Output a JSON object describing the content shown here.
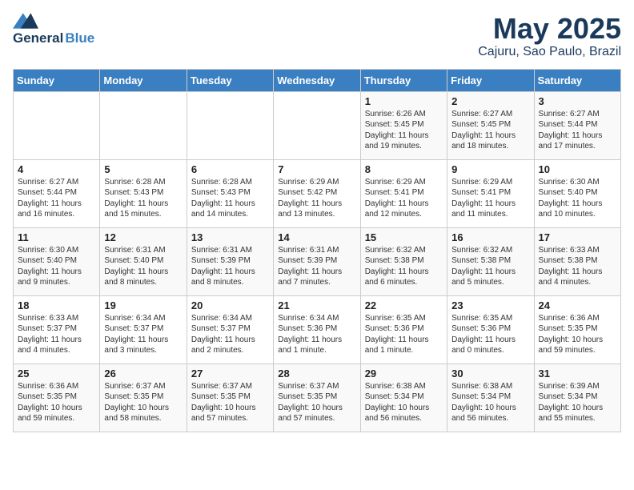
{
  "logo": {
    "general": "General",
    "blue": "Blue"
  },
  "title": "May 2025",
  "subtitle": "Cajuru, Sao Paulo, Brazil",
  "days_of_week": [
    "Sunday",
    "Monday",
    "Tuesday",
    "Wednesday",
    "Thursday",
    "Friday",
    "Saturday"
  ],
  "weeks": [
    [
      {
        "num": "",
        "info": ""
      },
      {
        "num": "",
        "info": ""
      },
      {
        "num": "",
        "info": ""
      },
      {
        "num": "",
        "info": ""
      },
      {
        "num": "1",
        "info": "Sunrise: 6:26 AM\nSunset: 5:45 PM\nDaylight: 11 hours\nand 19 minutes."
      },
      {
        "num": "2",
        "info": "Sunrise: 6:27 AM\nSunset: 5:45 PM\nDaylight: 11 hours\nand 18 minutes."
      },
      {
        "num": "3",
        "info": "Sunrise: 6:27 AM\nSunset: 5:44 PM\nDaylight: 11 hours\nand 17 minutes."
      }
    ],
    [
      {
        "num": "4",
        "info": "Sunrise: 6:27 AM\nSunset: 5:44 PM\nDaylight: 11 hours\nand 16 minutes."
      },
      {
        "num": "5",
        "info": "Sunrise: 6:28 AM\nSunset: 5:43 PM\nDaylight: 11 hours\nand 15 minutes."
      },
      {
        "num": "6",
        "info": "Sunrise: 6:28 AM\nSunset: 5:43 PM\nDaylight: 11 hours\nand 14 minutes."
      },
      {
        "num": "7",
        "info": "Sunrise: 6:29 AM\nSunset: 5:42 PM\nDaylight: 11 hours\nand 13 minutes."
      },
      {
        "num": "8",
        "info": "Sunrise: 6:29 AM\nSunset: 5:41 PM\nDaylight: 11 hours\nand 12 minutes."
      },
      {
        "num": "9",
        "info": "Sunrise: 6:29 AM\nSunset: 5:41 PM\nDaylight: 11 hours\nand 11 minutes."
      },
      {
        "num": "10",
        "info": "Sunrise: 6:30 AM\nSunset: 5:40 PM\nDaylight: 11 hours\nand 10 minutes."
      }
    ],
    [
      {
        "num": "11",
        "info": "Sunrise: 6:30 AM\nSunset: 5:40 PM\nDaylight: 11 hours\nand 9 minutes."
      },
      {
        "num": "12",
        "info": "Sunrise: 6:31 AM\nSunset: 5:40 PM\nDaylight: 11 hours\nand 8 minutes."
      },
      {
        "num": "13",
        "info": "Sunrise: 6:31 AM\nSunset: 5:39 PM\nDaylight: 11 hours\nand 8 minutes."
      },
      {
        "num": "14",
        "info": "Sunrise: 6:31 AM\nSunset: 5:39 PM\nDaylight: 11 hours\nand 7 minutes."
      },
      {
        "num": "15",
        "info": "Sunrise: 6:32 AM\nSunset: 5:38 PM\nDaylight: 11 hours\nand 6 minutes."
      },
      {
        "num": "16",
        "info": "Sunrise: 6:32 AM\nSunset: 5:38 PM\nDaylight: 11 hours\nand 5 minutes."
      },
      {
        "num": "17",
        "info": "Sunrise: 6:33 AM\nSunset: 5:38 PM\nDaylight: 11 hours\nand 4 minutes."
      }
    ],
    [
      {
        "num": "18",
        "info": "Sunrise: 6:33 AM\nSunset: 5:37 PM\nDaylight: 11 hours\nand 4 minutes."
      },
      {
        "num": "19",
        "info": "Sunrise: 6:34 AM\nSunset: 5:37 PM\nDaylight: 11 hours\nand 3 minutes."
      },
      {
        "num": "20",
        "info": "Sunrise: 6:34 AM\nSunset: 5:37 PM\nDaylight: 11 hours\nand 2 minutes."
      },
      {
        "num": "21",
        "info": "Sunrise: 6:34 AM\nSunset: 5:36 PM\nDaylight: 11 hours\nand 1 minute."
      },
      {
        "num": "22",
        "info": "Sunrise: 6:35 AM\nSunset: 5:36 PM\nDaylight: 11 hours\nand 1 minute."
      },
      {
        "num": "23",
        "info": "Sunrise: 6:35 AM\nSunset: 5:36 PM\nDaylight: 11 hours\nand 0 minutes."
      },
      {
        "num": "24",
        "info": "Sunrise: 6:36 AM\nSunset: 5:35 PM\nDaylight: 10 hours\nand 59 minutes."
      }
    ],
    [
      {
        "num": "25",
        "info": "Sunrise: 6:36 AM\nSunset: 5:35 PM\nDaylight: 10 hours\nand 59 minutes."
      },
      {
        "num": "26",
        "info": "Sunrise: 6:37 AM\nSunset: 5:35 PM\nDaylight: 10 hours\nand 58 minutes."
      },
      {
        "num": "27",
        "info": "Sunrise: 6:37 AM\nSunset: 5:35 PM\nDaylight: 10 hours\nand 57 minutes."
      },
      {
        "num": "28",
        "info": "Sunrise: 6:37 AM\nSunset: 5:35 PM\nDaylight: 10 hours\nand 57 minutes."
      },
      {
        "num": "29",
        "info": "Sunrise: 6:38 AM\nSunset: 5:34 PM\nDaylight: 10 hours\nand 56 minutes."
      },
      {
        "num": "30",
        "info": "Sunrise: 6:38 AM\nSunset: 5:34 PM\nDaylight: 10 hours\nand 56 minutes."
      },
      {
        "num": "31",
        "info": "Sunrise: 6:39 AM\nSunset: 5:34 PM\nDaylight: 10 hours\nand 55 minutes."
      }
    ]
  ]
}
